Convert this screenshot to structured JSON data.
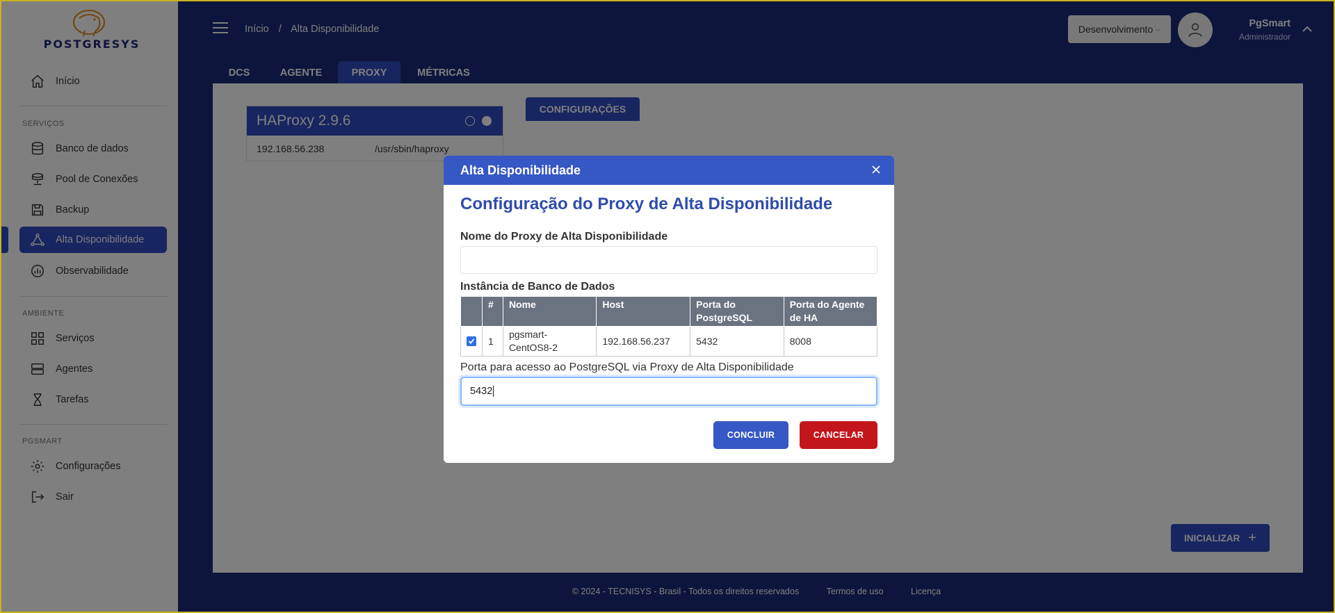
{
  "brand": {
    "name": "POSTGRESYS"
  },
  "sidebar": {
    "home": "Início",
    "sections": [
      {
        "label": "SERVIÇOS",
        "items": [
          {
            "label": "Banco de dados",
            "icon": "database-icon"
          },
          {
            "label": "Pool de Conexões",
            "icon": "pool-icon"
          },
          {
            "label": "Backup",
            "icon": "save-icon"
          },
          {
            "label": "Alta Disponibilidade",
            "icon": "cluster-icon",
            "active": true
          },
          {
            "label": "Observabilidade",
            "icon": "chart-icon"
          }
        ]
      },
      {
        "label": "AMBIENTE",
        "items": [
          {
            "label": "Serviços",
            "icon": "grid-icon"
          },
          {
            "label": "Agentes",
            "icon": "server-icon"
          },
          {
            "label": "Tarefas",
            "icon": "hourglass-icon"
          }
        ]
      },
      {
        "label": "PGSMART",
        "items": [
          {
            "label": "Configurações",
            "icon": "gear-icon"
          },
          {
            "label": "Sair",
            "icon": "logout-icon"
          }
        ]
      }
    ]
  },
  "header": {
    "breadcrumb": [
      "Início",
      "/",
      "Alta Disponibilidade"
    ],
    "environment": "Desenvolvimento",
    "user_name": "PgSmart",
    "user_role": "Administrador"
  },
  "tabs": [
    "DCS",
    "AGENTE",
    "PROXY",
    "MÉTRICAS"
  ],
  "active_tab": "PROXY",
  "proxy_card": {
    "title": "HAProxy 2.9.6",
    "ip": "192.168.56.238",
    "path": "/usr/sbin/haproxy"
  },
  "config_button": "CONFIGURAÇÕES",
  "init_button": "INICIALIZAR",
  "footer": {
    "copyright": "© 2024 - TECNISYS - Brasil - Todos os direitos reservados",
    "terms": "Termos de uso",
    "license": "Licença"
  },
  "modal": {
    "header": "Alta Disponibilidade",
    "title": "Configuração do Proxy de Alta Disponibilidade",
    "name_label": "Nome do Proxy de Alta Disponibilidade",
    "name_value": "",
    "instances_label": "Instância de Banco de Dados",
    "columns": [
      "#",
      "Nome",
      "Host",
      "Porta do PostgreSQL",
      "Porta do Agente de HA"
    ],
    "rows": [
      {
        "checked": true,
        "num": "1",
        "name": "pgsmart-CentOS8-2",
        "host": "192.168.56.237",
        "pg_port": "5432",
        "agent_port": "8008"
      }
    ],
    "port_label": "Porta para acesso ao PostgreSQL via Proxy de Alta Disponibilidade",
    "port_value": "5432",
    "ok_label": "CONCLUIR",
    "cancel_label": "CANCELAR"
  },
  "colors": {
    "primary": "#2f4bc0",
    "danger": "#c3161c",
    "dark_bg": "#1b2a78"
  }
}
